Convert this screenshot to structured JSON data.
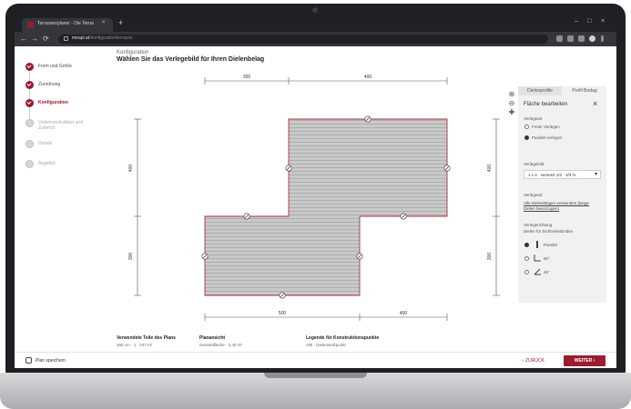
{
  "browser": {
    "tab_title": "Terrassenplaner - Die Terrasse u",
    "tab_close": "×",
    "new_tab": "+",
    "url_host": "meapi.at",
    "url_path": "/konfigurator/terrasse",
    "window_controls": [
      "–",
      "□",
      "×"
    ],
    "nav": [
      "←",
      "→",
      "⟳"
    ]
  },
  "stepper": {
    "steps": [
      {
        "label": "Form und Größe",
        "state": "done"
      },
      {
        "label": "Zuordnung",
        "state": "done"
      },
      {
        "label": "Konfiguration",
        "state": "current"
      },
      {
        "label": "Unterkonstruktion und Zubehör",
        "state": "todo"
      },
      {
        "label": "Details",
        "state": "todo"
      },
      {
        "label": "Angebot",
        "state": "todo"
      }
    ]
  },
  "header": {
    "crumb": "Konfiguration",
    "title": "Wählen Sie das Verlegebild für Ihren Dielenbelag"
  },
  "drawing": {
    "dim_top": [
      "300",
      "400"
    ],
    "dim_bottom": [
      "500",
      "400"
    ],
    "dim_left": [
      "400",
      "300"
    ],
    "dim_right": [
      "400",
      "300"
    ],
    "colors": {
      "board": "#c9c9c9",
      "board_line": "#a8a8a8",
      "outline": "#b03040"
    }
  },
  "panel": {
    "tabs": [
      "Dielenprofile",
      "Profil Bodag"
    ],
    "title": "Fläche bearbeiten",
    "close": "×",
    "section_verlegeart": "Verlegeart",
    "radio_1": "Freier Verlegen",
    "radio_2": "Parallel verlegen",
    "section_verlegebild": "Verlegebild",
    "select_value": "1 x 4 · versetzt 1/2 · 2/3 %",
    "select_chevron": "▾",
    "section_verlegeart2": "Verlegeart",
    "link_text": "Alle Dielenlängen verwenden (lange Dielen bevorzugen)",
    "section_richtung": "Verlegerichtung",
    "richtung_sub": "Dielen für Sichtseite/Enden",
    "option_1": "Parallel",
    "option_2": "90°",
    "option_3": "45°"
  },
  "zoom": [
    "⊕",
    "⊖",
    "✚"
  ],
  "info": {
    "headers": [
      "Verwendete Teile des Plans",
      "Planansicht",
      "Legende für Konstruktionspunkte"
    ],
    "values": [
      "300 cm  ·  1 · 247 m²",
      "Gesamtfläche · 2,40 m²",
      "A/B · Dielenstoßpunkt"
    ]
  },
  "footer": {
    "save": "Plan speichern",
    "back": "‹ ZURÜCK",
    "next": "WEITER ›"
  },
  "colors": {
    "accent": "#9b1b30",
    "panel_bg": "#f1f1f1"
  }
}
